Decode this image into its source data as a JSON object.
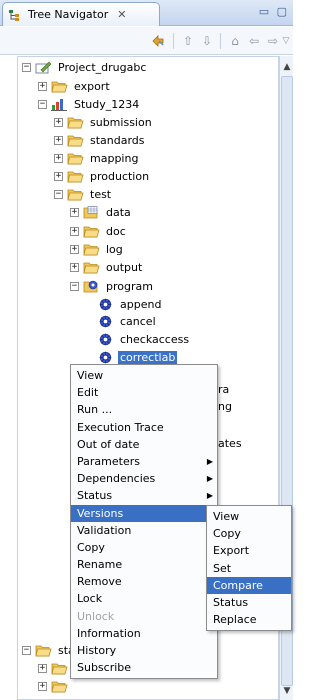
{
  "view": {
    "title": "Tree Navigator",
    "close_glyph": "✕",
    "window_controls": "▭ ▢"
  },
  "toolbar": {
    "buttons": [
      "sync-icon",
      "up-icon",
      "down-icon",
      "home-icon",
      "back-icon",
      "forward-icon",
      "view-menu-icon"
    ]
  },
  "tree": {
    "items": [
      {
        "label": "Project_drugabc",
        "icon": "project-icon",
        "expander": "−"
      },
      {
        "label": "export",
        "icon": "folder-icon",
        "expander": "+"
      },
      {
        "label": "Study_1234",
        "icon": "study-icon",
        "expander": "−"
      },
      {
        "label": "submission",
        "icon": "folder-icon",
        "expander": "+"
      },
      {
        "label": "standards",
        "icon": "folder-icon",
        "expander": "+"
      },
      {
        "label": "mapping",
        "icon": "folder-icon",
        "expander": "+"
      },
      {
        "label": "production",
        "icon": "folder-icon",
        "expander": "+"
      },
      {
        "label": "test",
        "icon": "folder-icon",
        "expander": "−"
      },
      {
        "label": "data",
        "icon": "data-folder-icon",
        "expander": "+"
      },
      {
        "label": "doc",
        "icon": "folder-icon",
        "expander": "+"
      },
      {
        "label": "log",
        "icon": "folder-icon",
        "expander": "+"
      },
      {
        "label": "output",
        "icon": "folder-icon",
        "expander": "+"
      },
      {
        "label": "program",
        "icon": "program-folder-icon",
        "expander": "−"
      },
      {
        "label": "append",
        "icon": "program-file-icon",
        "expander": ""
      },
      {
        "label": "cancel",
        "icon": "program-file-icon",
        "expander": ""
      },
      {
        "label": "checkaccess",
        "icon": "program-file-icon",
        "expander": ""
      },
      {
        "label": "correctlab",
        "icon": "program-file-icon",
        "expander": "",
        "selected": true
      }
    ],
    "partial_behind_menu": [
      "ra",
      "ng",
      "ates"
    ],
    "bottom_items": [
      {
        "label": "stan",
        "icon": "folder-icon",
        "expander": "−"
      },
      {
        "label": "",
        "icon": "folder-icon",
        "expander": "+"
      },
      {
        "label": "",
        "icon": "folder-icon",
        "expander": "+"
      },
      {
        "label": "",
        "icon": "folder-icon",
        "expander": "+"
      }
    ]
  },
  "context_menu": {
    "items": [
      {
        "label": "View"
      },
      {
        "label": "Edit"
      },
      {
        "label": "Run ..."
      },
      {
        "label": "Execution Trace"
      },
      {
        "label": "Out of date"
      },
      {
        "label": "Parameters",
        "submenu": true
      },
      {
        "label": "Dependencies",
        "submenu": true
      },
      {
        "label": "Status",
        "submenu": true
      },
      {
        "label": "Versions",
        "submenu": true,
        "highlighted": true
      },
      {
        "label": "Validation",
        "submenu": true
      },
      {
        "label": "Copy"
      },
      {
        "label": "Rename"
      },
      {
        "label": "Remove"
      },
      {
        "label": "Lock"
      },
      {
        "label": "Unlock",
        "disabled": true
      },
      {
        "label": "Information"
      },
      {
        "label": "History"
      },
      {
        "label": "Subscribe"
      }
    ]
  },
  "versions_submenu": {
    "items": [
      {
        "label": "View"
      },
      {
        "label": "Copy"
      },
      {
        "label": "Export"
      },
      {
        "label": "Set"
      },
      {
        "label": "Compare",
        "highlighted": true
      },
      {
        "label": "Status"
      },
      {
        "label": "Replace"
      }
    ]
  },
  "colors": {
    "selection": "#3a73c8",
    "menu_highlight": "#3a70c4",
    "folder": "#f2c94c"
  }
}
